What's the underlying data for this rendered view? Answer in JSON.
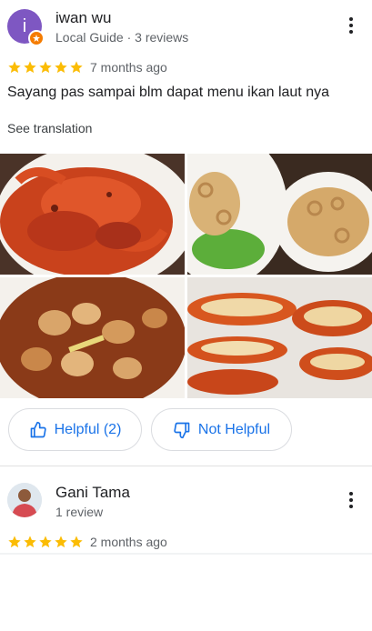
{
  "review1": {
    "avatar_letter": "i",
    "avatar_color": "#7e57c2",
    "author": "iwan wu",
    "meta": "Local Guide · 3 reviews",
    "rating": 5,
    "time_ago": "7 months ago",
    "text": "Sayang pas sampai blm dapat menu ikan laut nya",
    "see_translation": "See translation",
    "photos": [
      "chili-crab",
      "fried-squid-rings",
      "saucy-clams",
      "grilled-lobster"
    ],
    "helpful_label": "Helpful (2)",
    "not_helpful_label": "Not Helpful"
  },
  "review2": {
    "author": "Gani Tama",
    "meta": "1 review",
    "rating": 5,
    "time_ago": "2 months ago"
  },
  "colors": {
    "star": "#fbbc04",
    "accent": "#1a73e8",
    "badge": "#f57c00"
  }
}
